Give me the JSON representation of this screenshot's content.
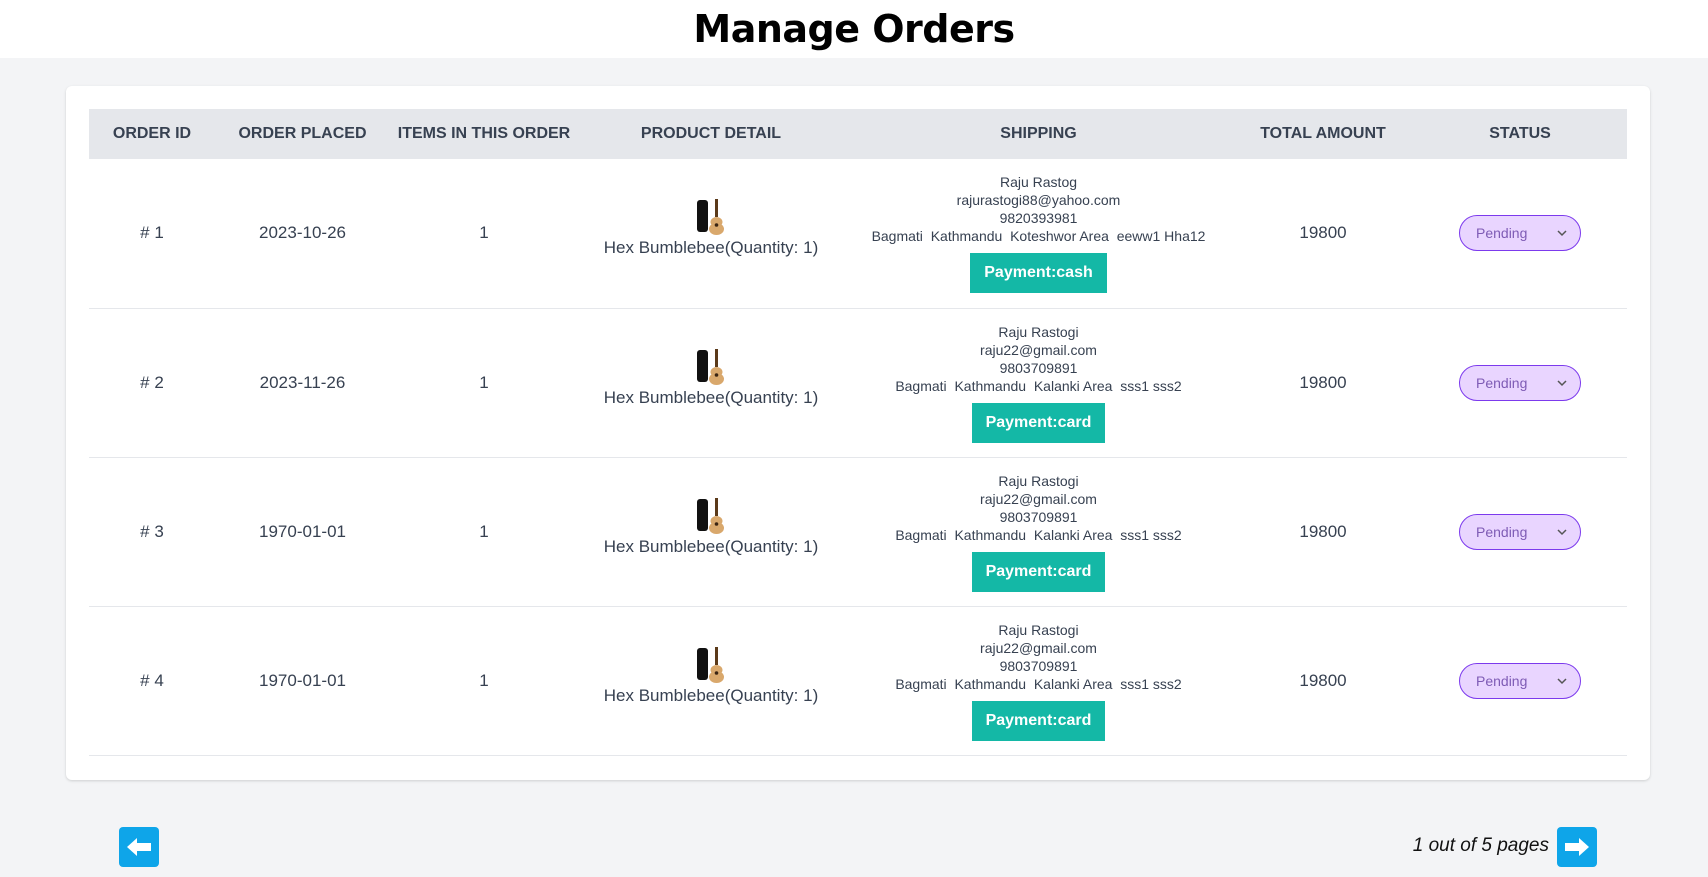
{
  "header": {
    "title": "Manage Orders"
  },
  "table": {
    "columns": [
      "ORDER ID",
      "ORDER PLACED",
      "ITEMS IN THIS ORDER",
      "PRODUCT DETAIL",
      "SHIPPING",
      "TOTAL AMOUNT",
      "STATUS"
    ],
    "rows": [
      {
        "order_id": "# 1",
        "placed": "2023-10-26",
        "items": "1",
        "product": "Hex Bumblebee(Quantity: 1)",
        "name": "Raju Rastog",
        "email": "rajurastogi88@yahoo.com",
        "phone": "9820393981",
        "address": "Bagmati  Kathmandu  Koteshwor Area  eeww1 Hha12",
        "payment": "Payment:cash",
        "total": "19800",
        "status": "Pending"
      },
      {
        "order_id": "# 2",
        "placed": "2023-11-26",
        "items": "1",
        "product": "Hex Bumblebee(Quantity: 1)",
        "name": "Raju Rastogi",
        "email": "raju22@gmail.com",
        "phone": "9803709891",
        "address": "Bagmati  Kathmandu  Kalanki Area  sss1 sss2",
        "payment": "Payment:card",
        "total": "19800",
        "status": "Pending"
      },
      {
        "order_id": "# 3",
        "placed": "1970-01-01",
        "items": "1",
        "product": "Hex Bumblebee(Quantity: 1)",
        "name": "Raju Rastogi",
        "email": "raju22@gmail.com",
        "phone": "9803709891",
        "address": "Bagmati  Kathmandu  Kalanki Area  sss1 sss2",
        "payment": "Payment:card",
        "total": "19800",
        "status": "Pending"
      },
      {
        "order_id": "# 4",
        "placed": "1970-01-01",
        "items": "1",
        "product": "Hex Bumblebee(Quantity: 1)",
        "name": "Raju Rastogi",
        "email": "raju22@gmail.com",
        "phone": "9803709891",
        "address": "Bagmati  Kathmandu  Kalanki Area  sss1 sss2",
        "payment": "Payment:card",
        "total": "19800",
        "status": "Pending"
      }
    ]
  },
  "pagination": {
    "info": "1 out of 5 pages",
    "prev_icon": "arrow-left-icon",
    "next_icon": "arrow-right-icon"
  },
  "colors": {
    "accent": "#0ea5e9",
    "payment": "#14b8a6",
    "status_bg": "#e9d5ff",
    "status_border": "#7c3aed"
  }
}
